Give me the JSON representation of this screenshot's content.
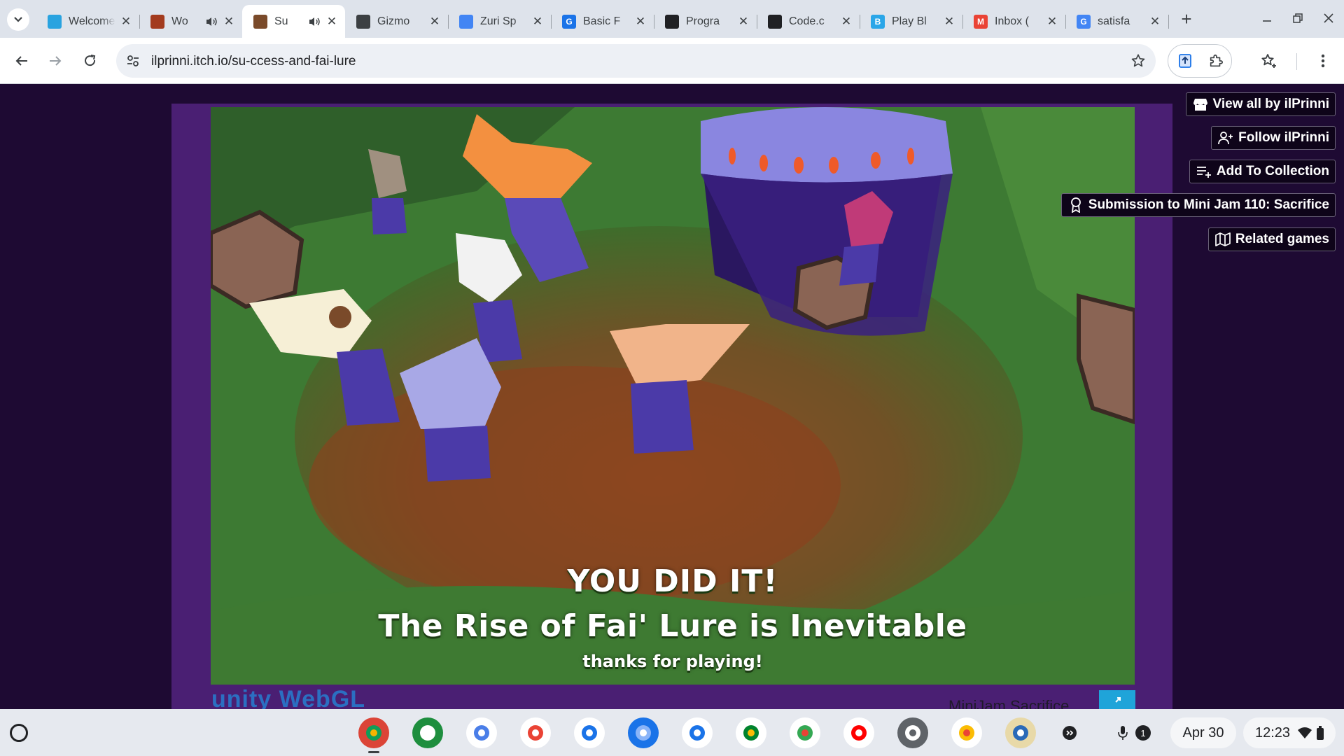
{
  "browser": {
    "tabs": [
      {
        "title": "Welcome",
        "icon": "blue-bird-favicon",
        "color": "#29a3e0",
        "sound": false,
        "active": false
      },
      {
        "title": "Wo",
        "icon": "game-favicon",
        "color": "#a33b1e",
        "sound": true,
        "active": false
      },
      {
        "title": "Su",
        "icon": "game-favicon",
        "color": "#7a4a2a",
        "sound": true,
        "active": true
      },
      {
        "title": "Gizmo",
        "icon": "contact-favicon",
        "color": "#3c4043",
        "sound": false,
        "active": false
      },
      {
        "title": "Zuri Sp",
        "icon": "docs-favicon",
        "color": "#4285f4",
        "sound": false,
        "active": false
      },
      {
        "title": "Basic F",
        "icon": "g-favicon",
        "color": "#1a73e8",
        "sound": false,
        "active": false
      },
      {
        "title": "Progra",
        "icon": "code-favicon",
        "color": "#202124",
        "sound": false,
        "active": false
      },
      {
        "title": "Code.c",
        "icon": "code-favicon",
        "color": "#202124",
        "sound": false,
        "active": false
      },
      {
        "title": "Play Bl",
        "icon": "b-favicon",
        "color": "#2aa6e8",
        "sound": false,
        "active": false
      },
      {
        "title": "Inbox (",
        "icon": "gmail-favicon",
        "color": "#ea4335",
        "sound": false,
        "active": false
      },
      {
        "title": "satisfa",
        "icon": "google-favicon",
        "color": "#4285f4",
        "sound": false,
        "active": false
      }
    ],
    "fav_letters": [
      "",
      "",
      "",
      "",
      "",
      "G",
      "",
      "",
      "B",
      "M",
      "G"
    ],
    "url": "ilprinni.itch.io/su-ccess-and-fai-lure"
  },
  "sidebar": {
    "view_all": "View all by ilPrinni",
    "follow": "Follow ilPrinni",
    "add_collection": "Add To Collection",
    "submission": "Submission to Mini Jam 110: Sacrifice",
    "related": "Related games"
  },
  "game": {
    "title": "YOU DID IT!",
    "subtitle": "The Rise of Fai' Lure is Inevitable",
    "thanks": "thanks for playing!",
    "engine": "unity WebGL",
    "jam": "MiniJam  Sacrifice"
  },
  "shelf": {
    "date": "Apr 30",
    "time": "12:23",
    "notifications": "1",
    "apps": [
      "chrome-icon",
      "app-launcher-icon",
      "gemini-icon",
      "gmail-icon",
      "calendar-icon",
      "files-icon",
      "messages-icon",
      "meet-icon",
      "play-store-icon",
      "youtube-icon",
      "settings-icon",
      "photos-icon",
      "game-app-icon"
    ]
  }
}
